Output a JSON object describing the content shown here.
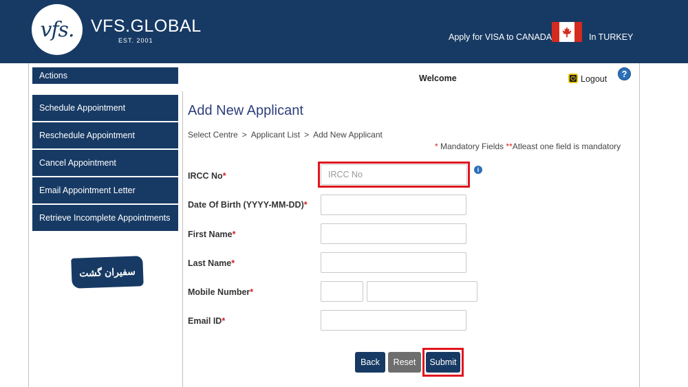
{
  "header": {
    "logo_text": "vfs.",
    "brand": "VFS.GLOBAL",
    "est": "EST. 2001",
    "apply_text": "Apply for VISA to CANADA",
    "location_text": "In TURKEY",
    "flag_colors": {
      "red": "#d52b1e",
      "white": "#ffffff"
    }
  },
  "sidebar": {
    "title": "Actions",
    "items": [
      {
        "label": "Schedule Appointment"
      },
      {
        "label": "Reschedule Appointment"
      },
      {
        "label": "Cancel Appointment"
      },
      {
        "label": "Email Appointment Letter"
      },
      {
        "label": "Retrieve Incomplete Appointments"
      }
    ],
    "watermark": "سفیران گشت"
  },
  "topbar": {
    "welcome": "Welcome",
    "logout": "Logout",
    "help_icon": "question-mark-icon"
  },
  "main": {
    "title": "Add New Applicant",
    "breadcrumb": [
      "Select Centre",
      "Applicant List",
      "Add New Applicant"
    ],
    "breadcrumb_sep": ">",
    "legend": {
      "single_star": "*",
      "mandatory": "Mandatory Fields",
      "double_star": "**",
      "one_field": "Atleast one field is mandatory"
    },
    "fields": {
      "ircc": {
        "label": "IRCC No",
        "placeholder": "IRCC No",
        "value": ""
      },
      "dob": {
        "label": "Date Of Birth (YYYY-MM-DD)",
        "value": ""
      },
      "first_name": {
        "label": "First Name",
        "value": ""
      },
      "last_name": {
        "label": "Last Name",
        "value": ""
      },
      "mobile": {
        "label": "Mobile Number",
        "code_value": "",
        "number_value": ""
      },
      "email": {
        "label": "Email ID",
        "value": ""
      }
    },
    "required_mark": "*",
    "buttons": {
      "back": "Back",
      "reset": "Reset",
      "submit": "Submit"
    }
  },
  "colors": {
    "primary": "#173a64",
    "highlight": "#e1141e",
    "required": "#d42020",
    "reset": "#6e6e6e"
  }
}
